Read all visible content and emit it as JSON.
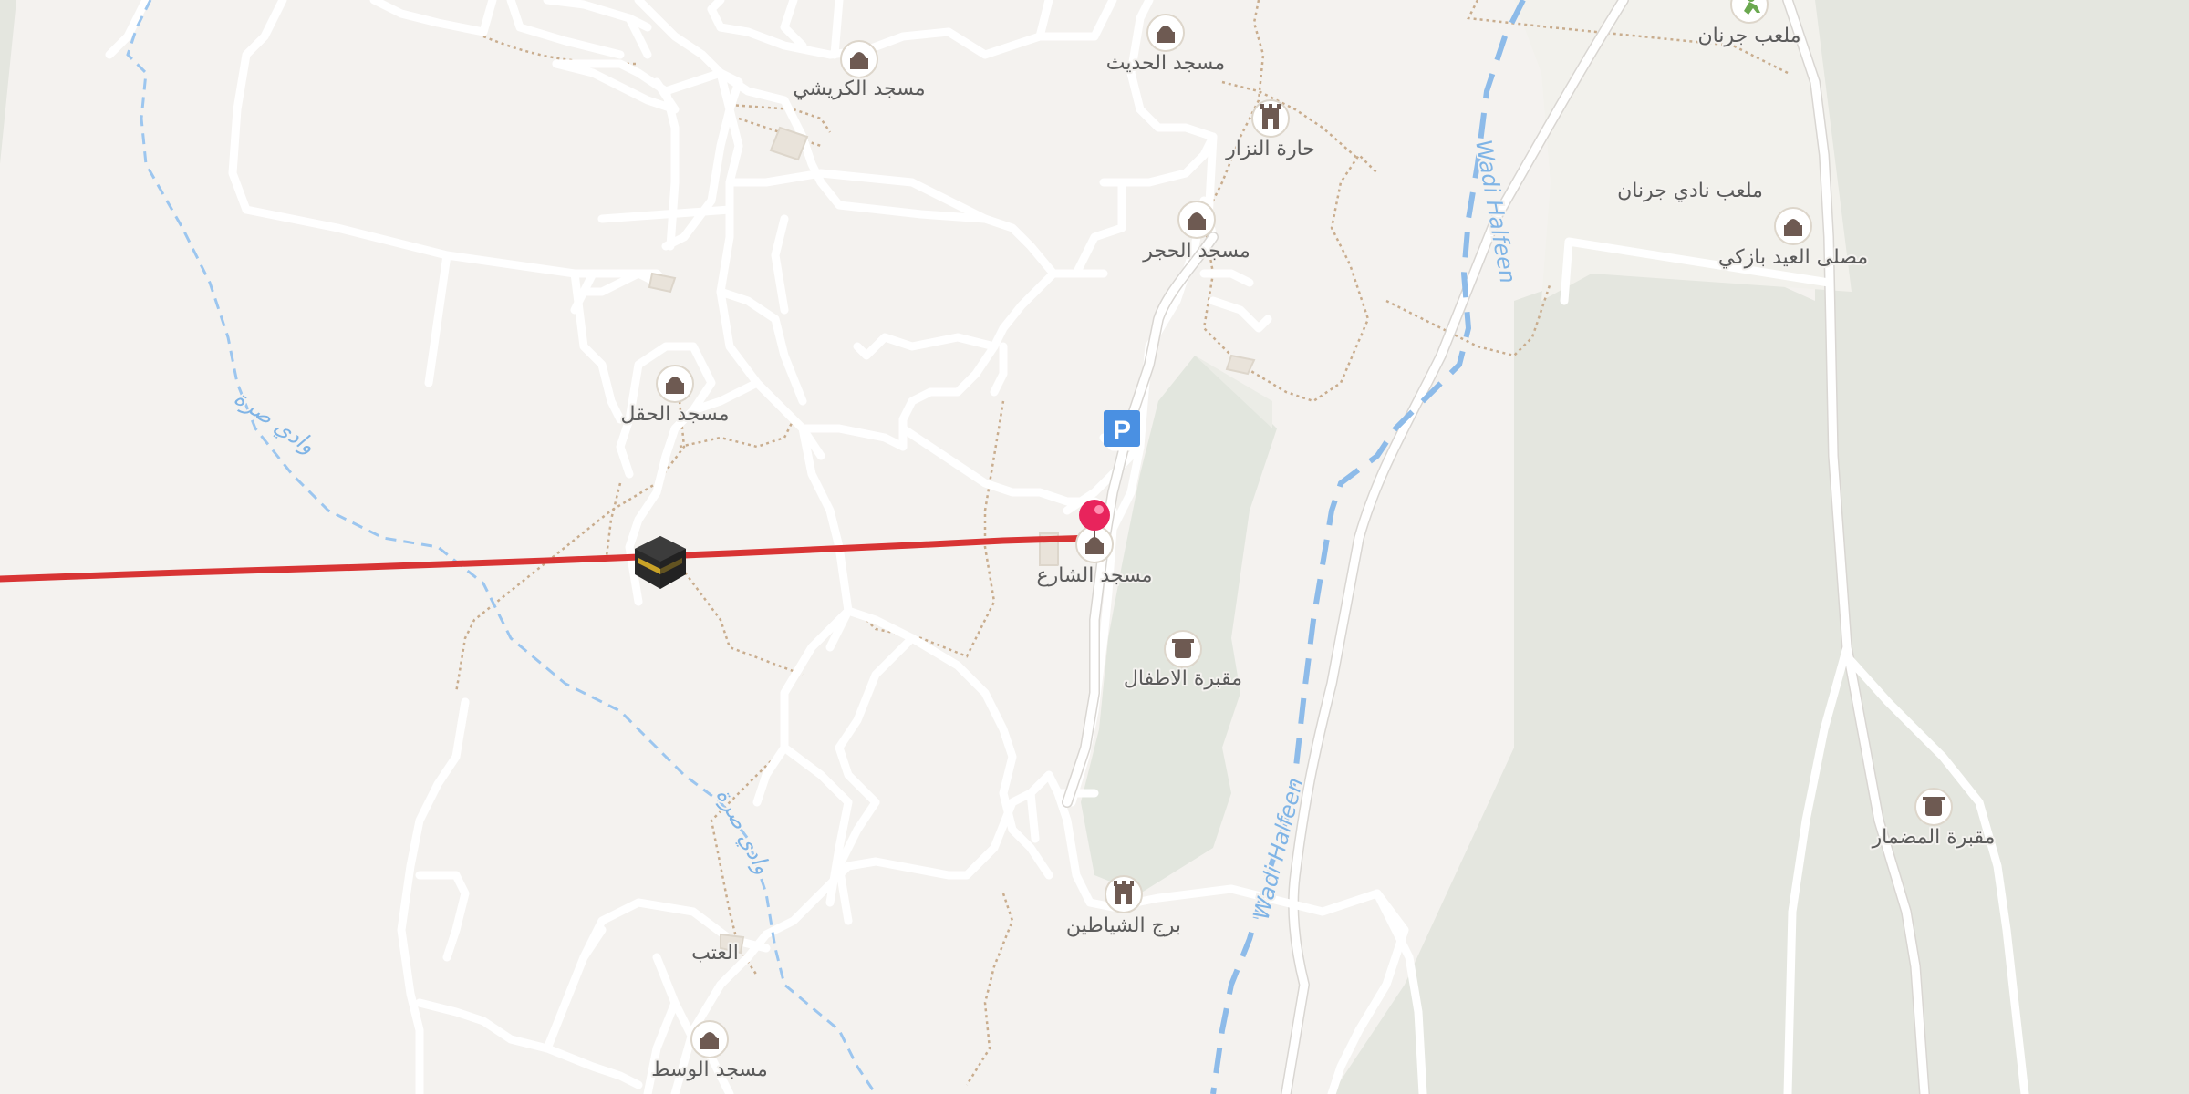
{
  "map": {
    "colors": {
      "land": "#f4f2ef",
      "green": "#e4e6df",
      "road": "#ffffff",
      "route": "#d83434",
      "water": "#8dbbe9",
      "poi_icon": "#6e5a52",
      "parking": "#4a90e2",
      "pin": "#e8245c"
    },
    "pois": [
      {
        "id": "poi-masjid-alkurayshi",
        "label": "مسجد الكريشي",
        "icon": "mosque-icon"
      },
      {
        "id": "poi-masjid-alhadith",
        "label": "مسجد الحديث",
        "icon": "mosque-icon"
      },
      {
        "id": "poi-malab-jarnan",
        "label": "ملعب جرنان",
        "icon": "sports-icon"
      },
      {
        "id": "poi-harat-alnizar",
        "label": "حارة النزار",
        "icon": "tower-icon"
      },
      {
        "id": "poi-malab-nadi-jarnan",
        "label": "ملعب نادي جرنان",
        "icon": ""
      },
      {
        "id": "poi-masjid-alhajar",
        "label": "مسجد الحجر",
        "icon": "mosque-icon"
      },
      {
        "id": "poi-musalla-aleid",
        "label": "مصلى العيد بازكي",
        "icon": "mosque-icon"
      },
      {
        "id": "poi-masjid-alhaql",
        "label": "مسجد الحقل",
        "icon": "mosque-icon"
      },
      {
        "id": "poi-masjid-alsharia",
        "label": "مسجد الشارع",
        "icon": "mosque-icon"
      },
      {
        "id": "poi-maqbarat-alatfal",
        "label": "مقبرة الاطفال",
        "icon": "cemetery-icon"
      },
      {
        "id": "poi-maqbarat-almadmar",
        "label": "مقبرة المضمار",
        "icon": "cemetery-icon"
      },
      {
        "id": "poi-burj-alshayatin",
        "label": "برج الشياطين",
        "icon": "tower-icon"
      },
      {
        "id": "poi-aletb",
        "label": "العتب",
        "icon": ""
      },
      {
        "id": "poi-masjid-alwasat",
        "label": "مسجد الوسط",
        "icon": "mosque-icon"
      }
    ],
    "waterways": {
      "wadi_upper": "Wadi Halfeen",
      "wadi_lower": "Wadi Halfeen",
      "stream_upper": "وادي صرة",
      "stream_lower": "وادي صرة"
    },
    "markers": {
      "parking": "P",
      "kaaba": "kaaba-icon",
      "pin": "map-pin-icon"
    }
  }
}
